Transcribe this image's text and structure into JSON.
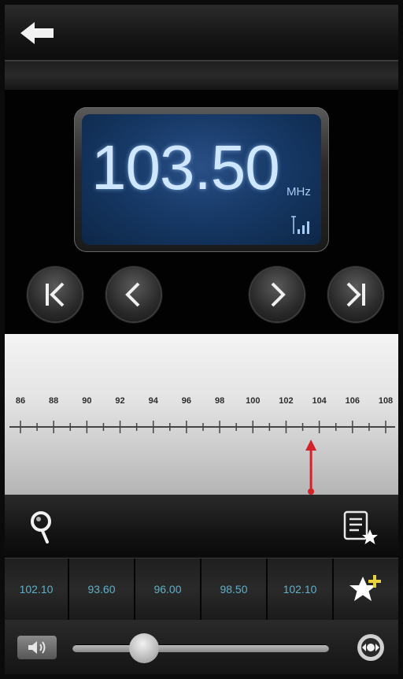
{
  "display": {
    "frequency": "103.50",
    "unit": "MHz"
  },
  "tuner": {
    "scale_labels": [
      "86",
      "88",
      "90",
      "92",
      "94",
      "96",
      "98",
      "100",
      "102",
      "104",
      "106",
      "108"
    ],
    "min_mhz": 86,
    "max_mhz": 108,
    "needle_mhz": 103.5
  },
  "presets": [
    "102.10",
    "93.60",
    "96.00",
    "98.50",
    "102.10"
  ],
  "volume": {
    "level": 0.28
  },
  "icons": {
    "back": "back-arrow-icon",
    "first": "skip-to-start-icon",
    "prev": "previous-icon",
    "next": "next-icon",
    "last": "skip-to-end-icon",
    "search": "search-icon",
    "favorite_list": "favorite-list-icon",
    "add_favorite": "add-favorite-star-icon",
    "mute": "speaker-icon",
    "output": "speaker-output-icon"
  },
  "colors": {
    "lcd_text": "#cfe6ff",
    "preset_text": "#5fb0c9",
    "needle": "#d2232a"
  }
}
